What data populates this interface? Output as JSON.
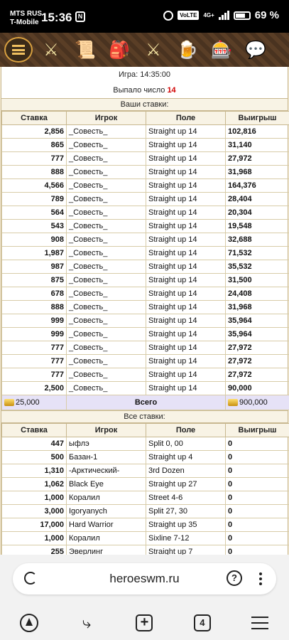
{
  "status_bar": {
    "carrier1": "MTS RUS",
    "carrier2": "T-Mobile",
    "time": "15:36",
    "nfc": "N",
    "volte": "VoLTE",
    "network": "4G+",
    "battery": "69 %"
  },
  "game_nav": {
    "icons": [
      "menu-icon",
      "knight-helmet-icon",
      "map-scroll-icon",
      "backpack-icon",
      "battle-swords-icon",
      "tavern-icon",
      "roulette-icon",
      "chat-icon"
    ]
  },
  "game": {
    "game_time": "Игра: 14:35:00",
    "result_prefix": "Выпало число",
    "result_number": "14"
  },
  "your_bets": {
    "title": "Ваши ставки:",
    "headers": [
      "Ставка",
      "Игрок",
      "Поле",
      "Выигрыш"
    ],
    "rows": [
      {
        "bet": "2,856",
        "player": "_Совесть_",
        "field": "Straight up 14",
        "win": "102,816"
      },
      {
        "bet": "865",
        "player": "_Совесть_",
        "field": "Straight up 14",
        "win": "31,140"
      },
      {
        "bet": "777",
        "player": "_Совесть_",
        "field": "Straight up 14",
        "win": "27,972"
      },
      {
        "bet": "888",
        "player": "_Совесть_",
        "field": "Straight up 14",
        "win": "31,968"
      },
      {
        "bet": "4,566",
        "player": "_Совесть_",
        "field": "Straight up 14",
        "win": "164,376"
      },
      {
        "bet": "789",
        "player": "_Совесть_",
        "field": "Straight up 14",
        "win": "28,404"
      },
      {
        "bet": "564",
        "player": "_Совесть_",
        "field": "Straight up 14",
        "win": "20,304"
      },
      {
        "bet": "543",
        "player": "_Совесть_",
        "field": "Straight up 14",
        "win": "19,548"
      },
      {
        "bet": "908",
        "player": "_Совесть_",
        "field": "Straight up 14",
        "win": "32,688"
      },
      {
        "bet": "1,987",
        "player": "_Совесть_",
        "field": "Straight up 14",
        "win": "71,532"
      },
      {
        "bet": "987",
        "player": "_Совесть_",
        "field": "Straight up 14",
        "win": "35,532"
      },
      {
        "bet": "875",
        "player": "_Совесть_",
        "field": "Straight up 14",
        "win": "31,500"
      },
      {
        "bet": "678",
        "player": "_Совесть_",
        "field": "Straight up 14",
        "win": "24,408"
      },
      {
        "bet": "888",
        "player": "_Совесть_",
        "field": "Straight up 14",
        "win": "31,968"
      },
      {
        "bet": "999",
        "player": "_Совесть_",
        "field": "Straight up 14",
        "win": "35,964"
      },
      {
        "bet": "999",
        "player": "_Совесть_",
        "field": "Straight up 14",
        "win": "35,964"
      },
      {
        "bet": "777",
        "player": "_Совесть_",
        "field": "Straight up 14",
        "win": "27,972"
      },
      {
        "bet": "777",
        "player": "_Совесть_",
        "field": "Straight up 14",
        "win": "27,972"
      },
      {
        "bet": "777",
        "player": "_Совесть_",
        "field": "Straight up 14",
        "win": "27,972"
      },
      {
        "bet": "2,500",
        "player": "_Совесть_",
        "field": "Straight up 14",
        "win": "90,000"
      }
    ],
    "total": {
      "bet": "25,000",
      "label": "Всего",
      "win": "900,000"
    }
  },
  "all_bets": {
    "title": "Все ставки:",
    "headers": [
      "Ставка",
      "Игрок",
      "Поле",
      "Выигрыш"
    ],
    "rows": [
      {
        "bet": "447",
        "player": "ыфлэ",
        "field": "Split 0, 00",
        "win": "0"
      },
      {
        "bet": "500",
        "player": "Базан-1",
        "field": "Straight up 4",
        "win": "0"
      },
      {
        "bet": "1,310",
        "player": "-Арктический-",
        "field": "3rd Dozen",
        "win": "0"
      },
      {
        "bet": "1,062",
        "player": "Black Eye",
        "field": "Straight up 27",
        "win": "0"
      },
      {
        "bet": "1,000",
        "player": "Коралил",
        "field": "Street 4-6",
        "win": "0"
      },
      {
        "bet": "3,000",
        "player": "Igoryanych",
        "field": "Split 27, 30",
        "win": "0"
      },
      {
        "bet": "17,000",
        "player": "Hard Warrior",
        "field": "Straight up 35",
        "win": "0"
      },
      {
        "bet": "1,000",
        "player": "Коралил",
        "field": "Sixline 7-12",
        "win": "0"
      },
      {
        "bet": "255",
        "player": "Эверлинг",
        "field": "Straight up 7",
        "win": "0"
      }
    ]
  },
  "browser": {
    "url": "heroeswm.ru",
    "tab_count": "4"
  }
}
